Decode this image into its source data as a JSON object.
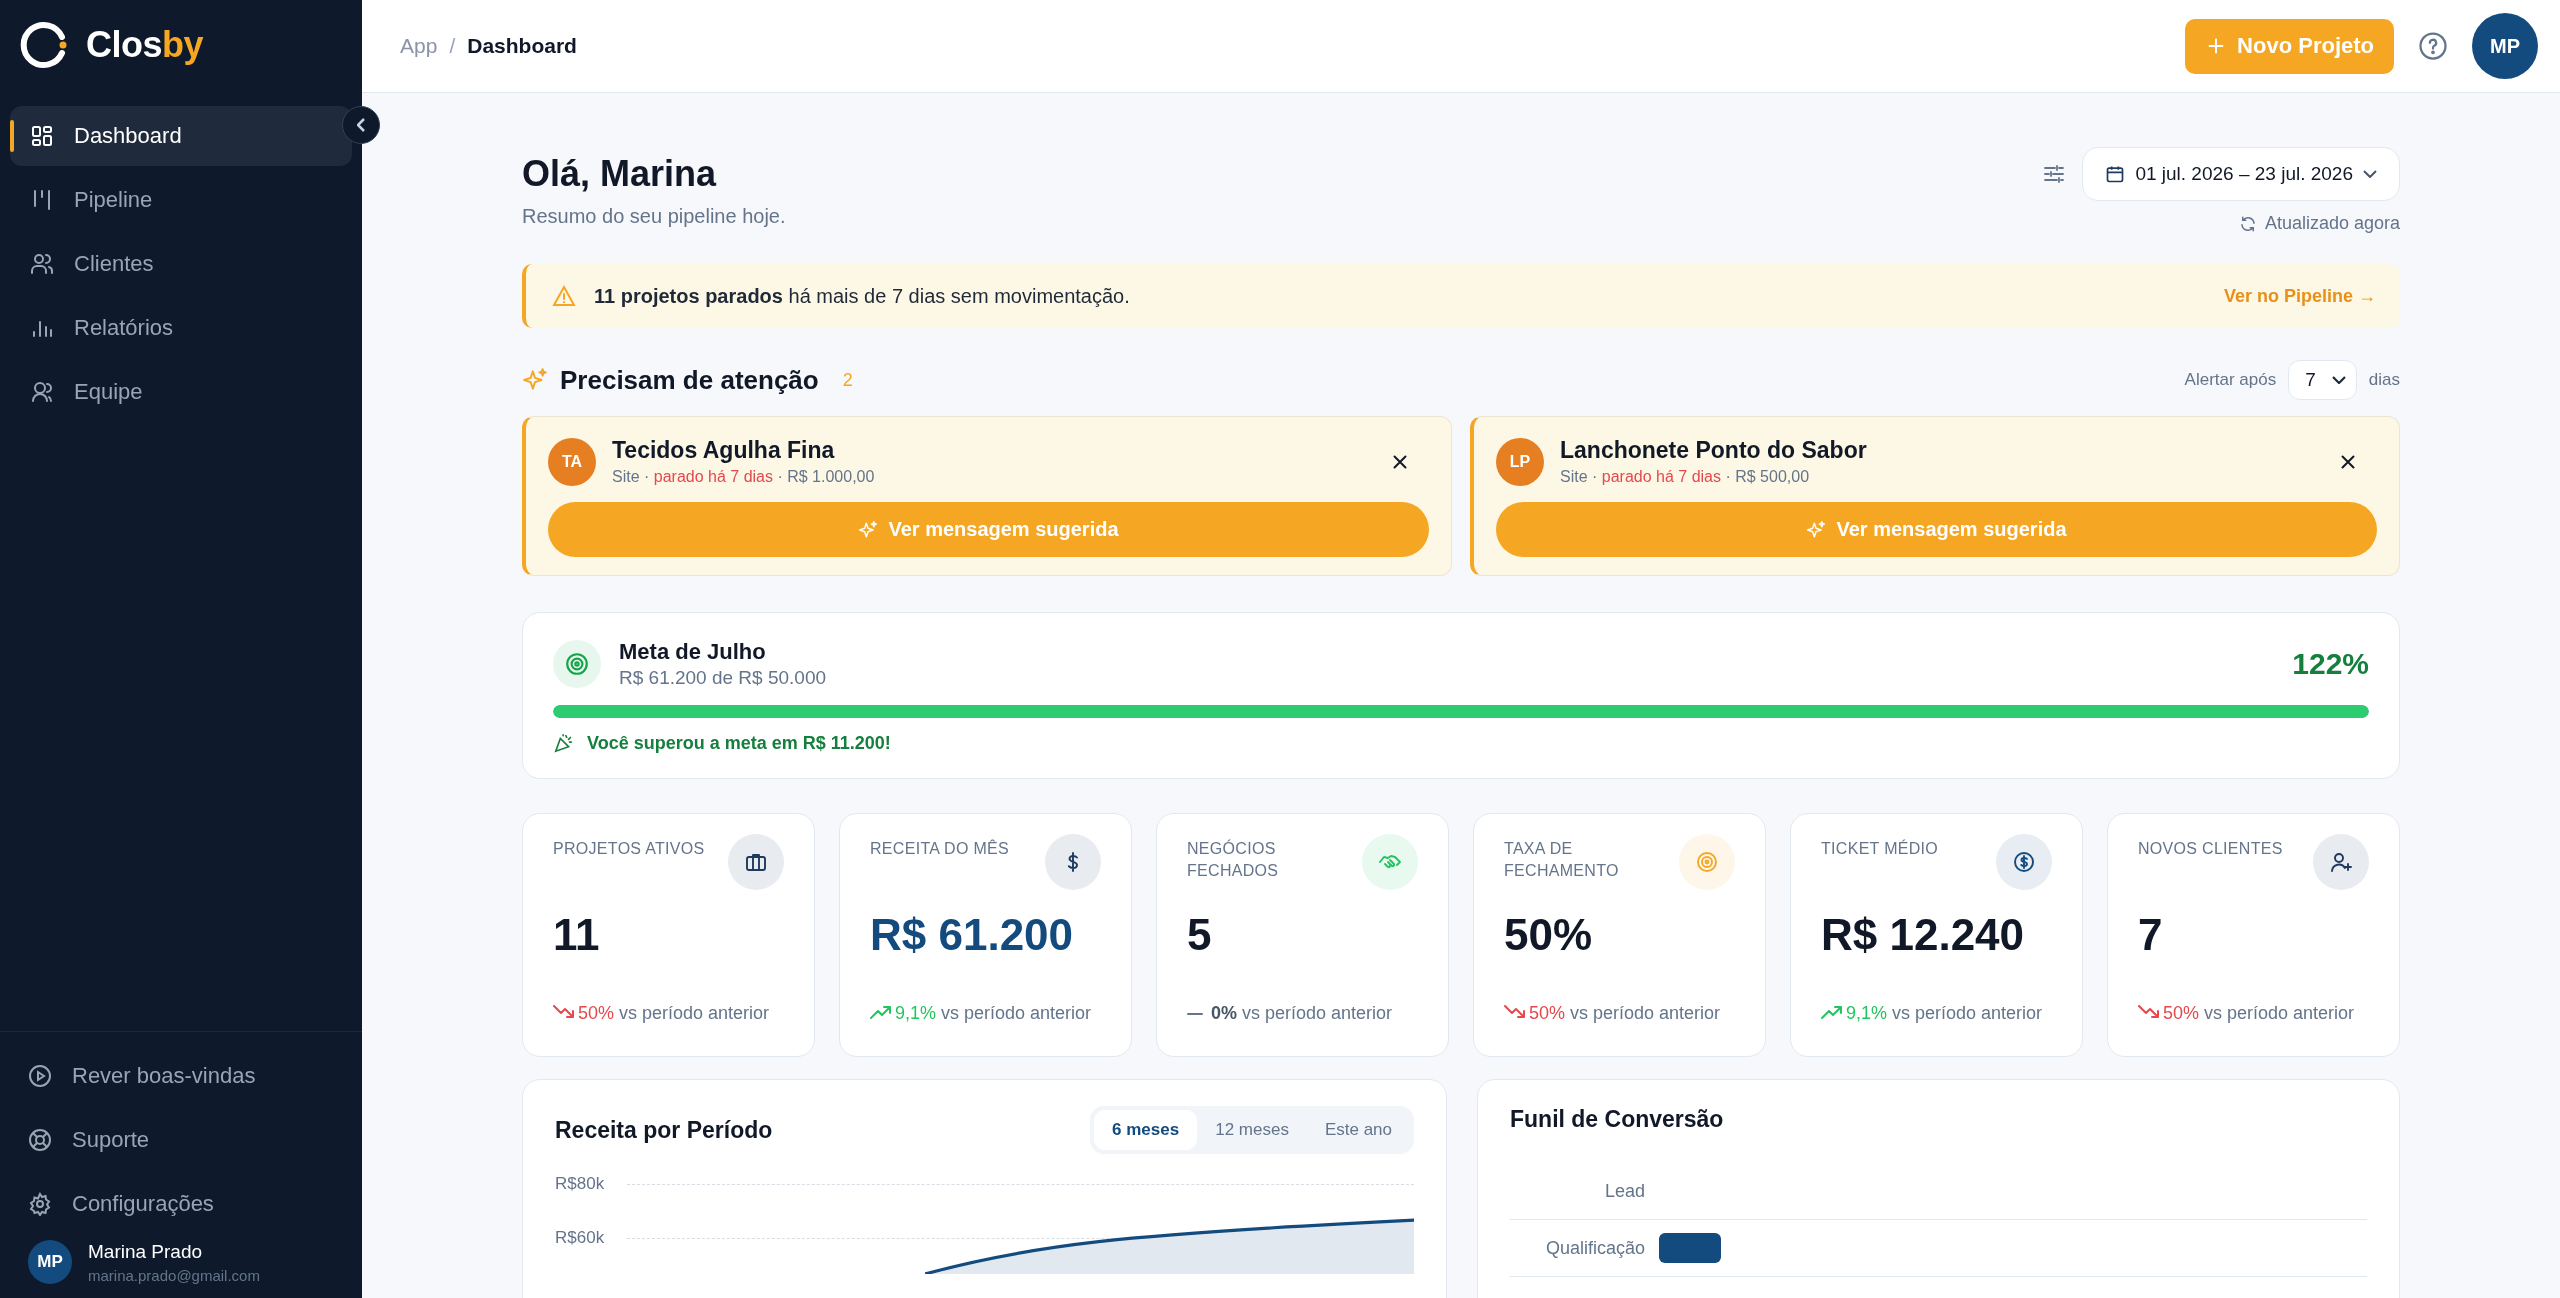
{
  "sidebar": {
    "logo": {
      "first": "Clos",
      "second": "by"
    },
    "items": [
      {
        "label": "Dashboard",
        "kind": "grid",
        "selected": true
      },
      {
        "label": "Pipeline",
        "kind": "columns",
        "selected": false
      },
      {
        "label": "Clientes",
        "kind": "users",
        "selected": false
      },
      {
        "label": "Relatórios",
        "kind": "bars",
        "selected": false
      },
      {
        "label": "Equipe",
        "kind": "team",
        "selected": false
      }
    ],
    "bottom_items": [
      {
        "label": "Rever boas-vindas",
        "kind": "play"
      },
      {
        "label": "Suporte",
        "kind": "lifebuoy"
      },
      {
        "label": "Configurações",
        "kind": "gear"
      }
    ],
    "user": {
      "initials": "MP",
      "name": "Marina Prado",
      "email": "marina.prado@gmail.com"
    }
  },
  "header": {
    "breadcrumb": [
      "App",
      "Dashboard"
    ],
    "separator": "/",
    "new_button": "Novo Projeto",
    "avatar": "MP"
  },
  "greeting": {
    "title": "Olá, Marina",
    "subtitle": "Resumo do seu pipeline hoje.",
    "date_range": "01 jul. 2026 – 23 jul. 2026",
    "updated": "Atualizado agora"
  },
  "alert": {
    "text": "**11 projetos parados** há mais de 7 dias sem movimentação.",
    "link": "Ver no Pipeline →"
  },
  "attention": {
    "title": "Precisam de atenção",
    "count": "2",
    "threshold_label": "Alertar após",
    "threshold_value": "7",
    "threshold_unit": "dias",
    "separator": "·",
    "cards": [
      {
        "initials": "TA",
        "name": "Tecidos Agulha Fina",
        "details": [
          {
            "text": "Site",
            "alert": false
          },
          {
            "text": "parado há 7 dias",
            "alert": true
          },
          {
            "text": "R$ 1.000,00",
            "alert": false
          }
        ],
        "action": "Ver mensagem sugerida"
      },
      {
        "initials": "LP",
        "name": "Lanchonete Ponto do Sabor",
        "details": [
          {
            "text": "Site",
            "alert": false
          },
          {
            "text": "parado há 7 dias",
            "alert": true
          },
          {
            "text": "R$ 500,00",
            "alert": false
          }
        ],
        "action": "Ver mensagem sugerida"
      }
    ]
  },
  "goal": {
    "title": "Meta de Julho",
    "subtitle": "R$ 61.200 de R$ 50.000",
    "percent": "122%",
    "level": 1,
    "message": "Você superou a meta em R$ 11.200!"
  },
  "kpis": [
    {
      "label": "PROJETOS ATIVOS",
      "kind": "briefcase",
      "color": "#1e3a5f",
      "value": "11",
      "highlight": false,
      "change": {
        "kind": "down",
        "text": "50%"
      },
      "comparison": "vs período anterior"
    },
    {
      "label": "RECEITA DO MÊS",
      "kind": "dollar",
      "color": "#1e3a5f",
      "value": "R$ 61.200",
      "highlight": true,
      "change": {
        "kind": "up",
        "text": "9,1%"
      },
      "comparison": "vs período anterior"
    },
    {
      "label": "NEGÓCIOS FECHADOS",
      "kind": "handshake",
      "color": "#22c55e",
      "value": "5",
      "highlight": false,
      "change": {
        "kind": "flat",
        "text": "0%"
      },
      "comparison": "vs período anterior"
    },
    {
      "label": "TAXA DE FECHAMENTO",
      "kind": "target",
      "color": "#f5a623",
      "value": "50%",
      "highlight": false,
      "change": {
        "kind": "down",
        "text": "50%"
      },
      "comparison": "vs período anterior"
    },
    {
      "label": "TICKET MÉDIO",
      "kind": "coin",
      "color": "#134b7f",
      "value": "R$ 12.240",
      "highlight": false,
      "change": {
        "kind": "up",
        "text": "9,1%"
      },
      "comparison": "vs período anterior"
    },
    {
      "label": "NOVOS CLIENTES",
      "kind": "user-plus",
      "color": "#1e3a5f",
      "value": "7",
      "highlight": false,
      "change": {
        "kind": "down",
        "text": "50%"
      },
      "comparison": "vs período anterior"
    }
  ],
  "revenue": {
    "title": "Receita por Período",
    "tabs": [
      {
        "label": "6 meses",
        "selected": true
      },
      {
        "label": "12 meses",
        "selected": false
      },
      {
        "label": "Este ano",
        "selected": false
      }
    ],
    "y_labels": [
      "R$80k",
      "R$60k"
    ]
  },
  "funnel": {
    "title": "Funil de Conversão",
    "stages": [
      {
        "label": "Lead",
        "bar": false
      },
      {
        "label": "Qualificação",
        "bar": true
      }
    ]
  }
}
